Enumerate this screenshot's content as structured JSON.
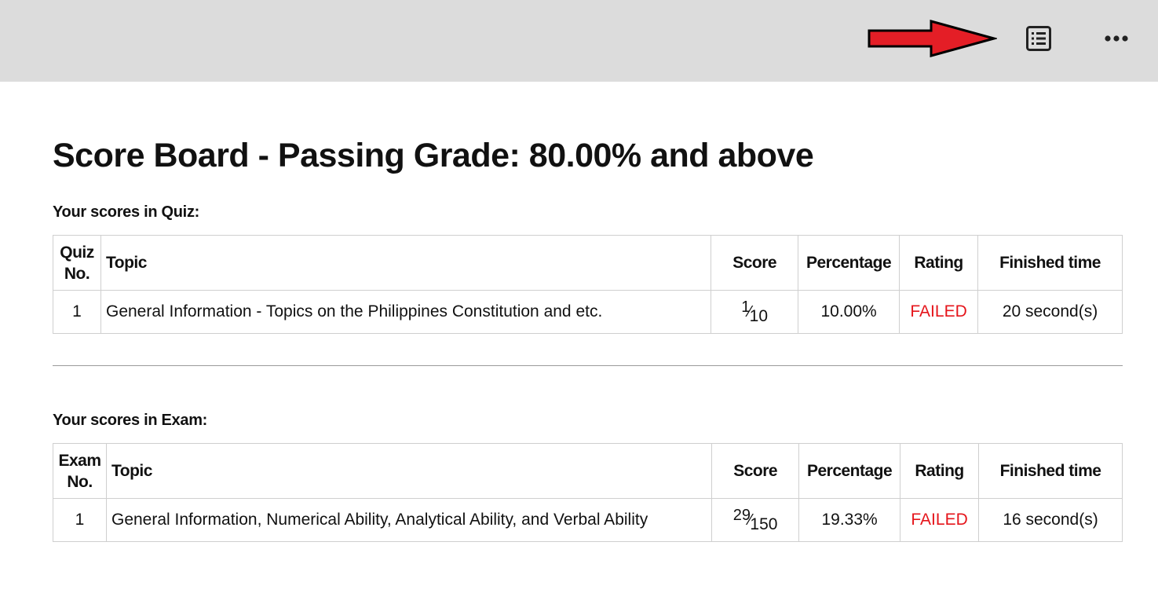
{
  "toolbar": {
    "list_icon": "list-icon",
    "more_icon": "more-horizontal-icon",
    "arrow_color": "#e41e26"
  },
  "page": {
    "title": "Score Board - Passing Grade: 80.00% and above"
  },
  "quiz": {
    "label": "Your scores in Quiz:",
    "headers": {
      "no_line1": "Quiz",
      "no_line2": "No.",
      "topic": "Topic",
      "score": "Score",
      "percentage": "Percentage",
      "rating": "Rating",
      "finished_time": "Finished time"
    },
    "rows": [
      {
        "no": "1",
        "topic": "General Information - Topics on the Philippines Constitution and etc.",
        "score_num": "1",
        "score_den": "10",
        "percentage": "10.00%",
        "rating": "FAILED",
        "finished_time": "20 second(s)"
      }
    ]
  },
  "exam": {
    "label": "Your scores in Exam:",
    "headers": {
      "no_line1": "Exam",
      "no_line2": "No.",
      "topic": "Topic",
      "score": "Score",
      "percentage": "Percentage",
      "rating": "Rating",
      "finished_time": "Finished time"
    },
    "rows": [
      {
        "no": "1",
        "topic": "General Information, Numerical Ability, Analytical Ability, and Verbal Ability",
        "score_num": "29",
        "score_den": "150",
        "percentage": "19.33%",
        "rating": "FAILED",
        "finished_time": "16 second(s)"
      }
    ]
  },
  "colors": {
    "topbar": "#dcdcdc",
    "failed": "#e5151b",
    "border": "#cfcfcf"
  }
}
